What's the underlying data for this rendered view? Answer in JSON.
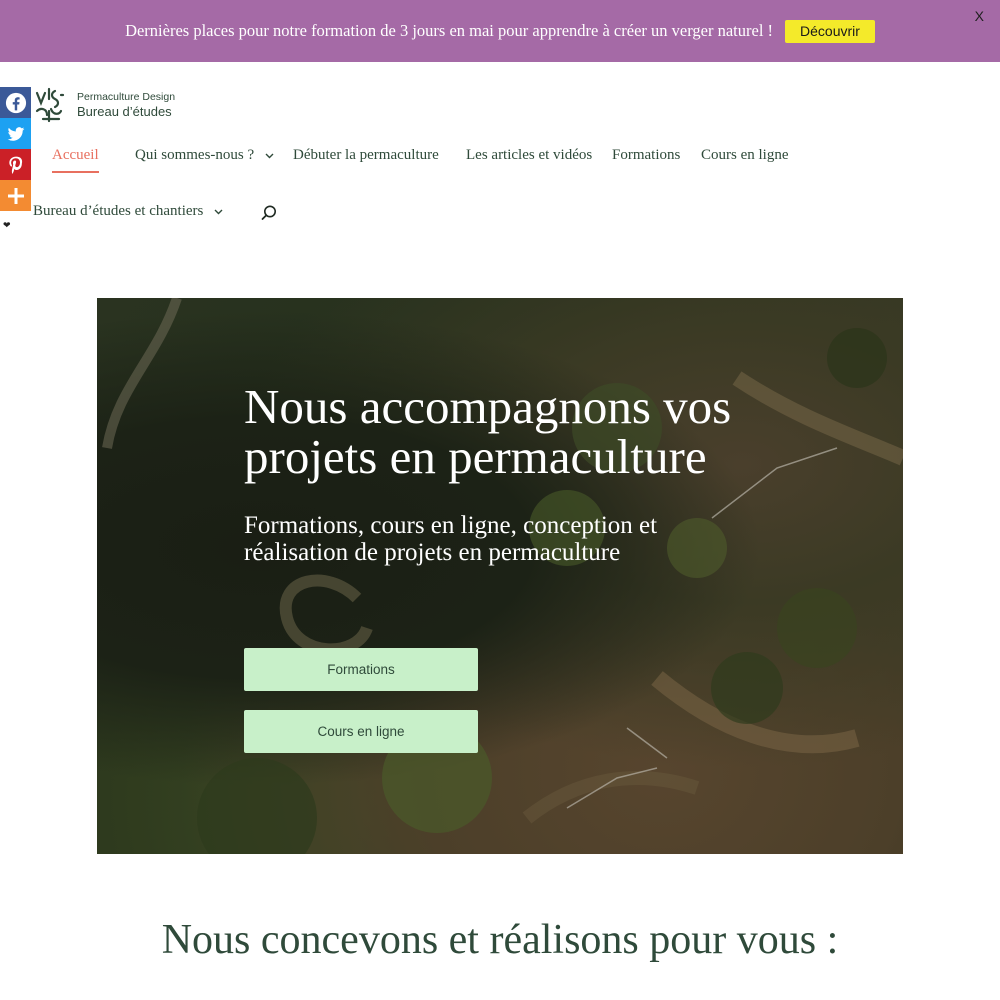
{
  "banner": {
    "text": "Dernières places pour notre formation de 3 jours en mai pour apprendre à créer un verger naturel !",
    "cta_label": "Découvrir",
    "close_label": "X",
    "background": "#a56aa6",
    "cta_color": "#f4ea2a"
  },
  "share": {
    "items": [
      {
        "name": "facebook-icon",
        "color": "#3b5998"
      },
      {
        "name": "twitter-icon",
        "color": "#1da1f2"
      },
      {
        "name": "pinterest-icon",
        "color": "#cb2027"
      },
      {
        "name": "plus-icon",
        "color": "#f38b32"
      }
    ]
  },
  "logo": {
    "line1": "Permaculture Design",
    "line2": "Bureau d’études"
  },
  "nav": {
    "items": [
      {
        "label": "Accueil",
        "active": true
      },
      {
        "label": "Qui sommes-nous ?",
        "has_dropdown": true
      },
      {
        "label": "Débuter la permaculture"
      },
      {
        "label": "Les articles et vidéos"
      },
      {
        "label": "Formations"
      },
      {
        "label": "Cours en ligne"
      },
      {
        "label": "Bureau d’études et chantiers",
        "has_dropdown": true
      }
    ],
    "active_color": "#e8705f",
    "text_color": "#2f4a3a"
  },
  "hero": {
    "title": "Nous accompagnons vos projets en permaculture",
    "subtitle": "Formations, cours en ligne, conception et réalisation de projets en permaculture",
    "buttons": [
      {
        "label": "Formations"
      },
      {
        "label": "Cours en ligne"
      }
    ],
    "button_color": "#c8f0c9"
  },
  "section": {
    "title": "Nous concevons et réalisons pour vous :"
  }
}
